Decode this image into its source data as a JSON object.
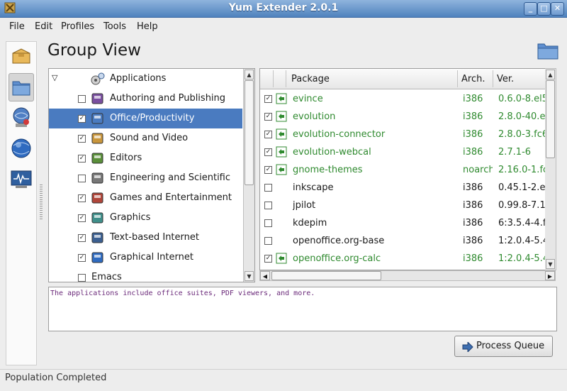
{
  "window": {
    "title": "Yum Extender 2.0.1"
  },
  "menu": {
    "file": "File",
    "edit": "Edit",
    "profiles": "Profiles",
    "tools": "Tools",
    "help": "Help"
  },
  "header": {
    "title": "Group View"
  },
  "groups": {
    "root": "Applications",
    "items": [
      {
        "label": "Authoring and Publishing",
        "checked": false,
        "selected": false
      },
      {
        "label": "Office/Productivity",
        "checked": true,
        "selected": true
      },
      {
        "label": "Sound and Video",
        "checked": true,
        "selected": false
      },
      {
        "label": "Editors",
        "checked": true,
        "selected": false
      },
      {
        "label": "Engineering and Scientific",
        "checked": false,
        "selected": false
      },
      {
        "label": "Games and Entertainment",
        "checked": true,
        "selected": false
      },
      {
        "label": "Graphics",
        "checked": true,
        "selected": false
      },
      {
        "label": "Text-based Internet",
        "checked": true,
        "selected": false
      },
      {
        "label": "Graphical Internet",
        "checked": true,
        "selected": false
      },
      {
        "label": "Emacs",
        "checked": false,
        "selected": false
      }
    ]
  },
  "packages": {
    "columns": {
      "package": "Package",
      "arch": "Arch.",
      "ver": "Ver."
    },
    "rows": [
      {
        "name": "evince",
        "arch": "i386",
        "ver": "0.6.0-8.el5",
        "checked": true,
        "installed": true
      },
      {
        "name": "evolution",
        "arch": "i386",
        "ver": "2.8.0-40.e",
        "checked": true,
        "installed": true
      },
      {
        "name": "evolution-connector",
        "arch": "i386",
        "ver": "2.8.0-3.fc6",
        "checked": true,
        "installed": true
      },
      {
        "name": "evolution-webcal",
        "arch": "i386",
        "ver": "2.7.1-6",
        "checked": true,
        "installed": true
      },
      {
        "name": "gnome-themes",
        "arch": "noarch",
        "ver": "2.16.0-1.fc",
        "checked": true,
        "installed": true
      },
      {
        "name": "inkscape",
        "arch": "i386",
        "ver": "0.45.1-2.e",
        "checked": false,
        "installed": false
      },
      {
        "name": "jpilot",
        "arch": "i386",
        "ver": "0.99.8-7.1",
        "checked": false,
        "installed": false
      },
      {
        "name": "kdepim",
        "arch": "i386",
        "ver": "6:3.5.4-4.f",
        "checked": false,
        "installed": false
      },
      {
        "name": "openoffice.org-base",
        "arch": "i386",
        "ver": "1:2.0.4-5.4",
        "checked": false,
        "installed": false
      },
      {
        "name": "openoffice.org-calc",
        "arch": "i386",
        "ver": "1:2.0.4-5.4",
        "checked": true,
        "installed": true
      }
    ]
  },
  "description": "The applications include office suites, PDF viewers, and more.",
  "process_button": "Process Queue",
  "status": "Population Completed",
  "colors": {
    "selection": "#4a7bc0",
    "installed_text": "#2f8a2f",
    "description_text": "#6b2a7a"
  }
}
